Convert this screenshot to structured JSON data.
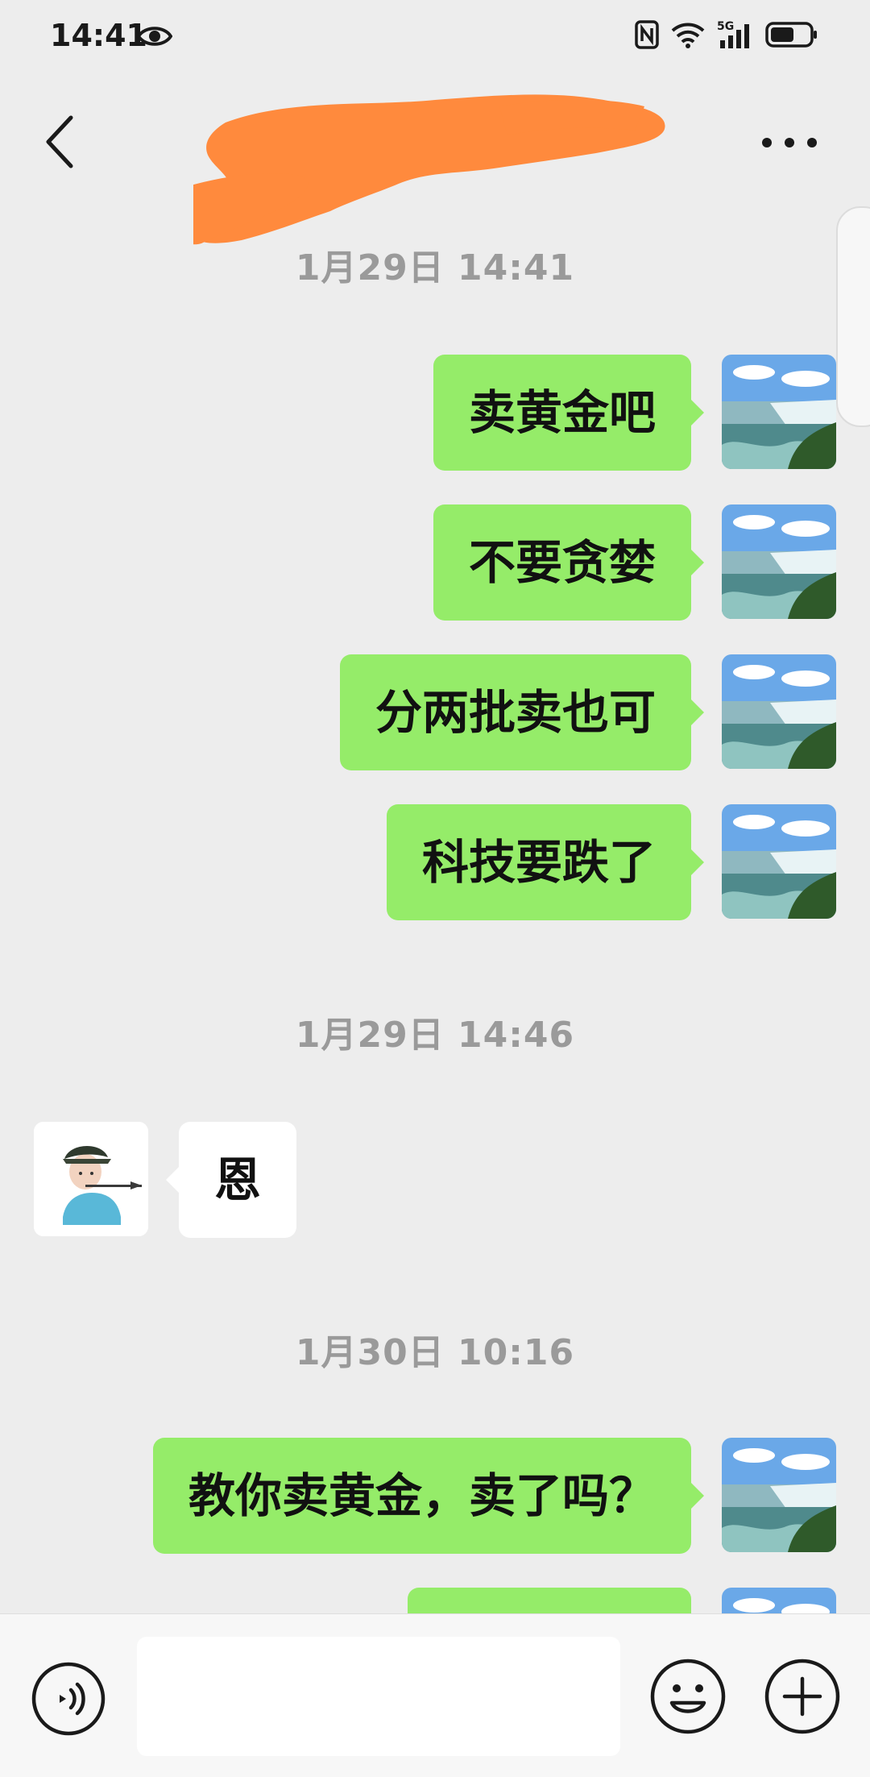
{
  "status_bar": {
    "time": "14:41",
    "network_label": "5G",
    "battery_level": 0.6
  },
  "header": {
    "title": "",
    "title_redacted": true,
    "back_icon": "chevron-left-icon",
    "more_icon": "more-dots-icon"
  },
  "messages": [
    {
      "type": "timestamp",
      "text": "1月29日 14:41"
    },
    {
      "type": "message",
      "sender": "self",
      "text": "卖黄金吧"
    },
    {
      "type": "message",
      "sender": "self",
      "text": "不要贪婪"
    },
    {
      "type": "message",
      "sender": "self",
      "text": "分两批卖也可"
    },
    {
      "type": "message",
      "sender": "self",
      "text": "科技要跌了"
    },
    {
      "type": "timestamp",
      "text": "1月29日 14:46"
    },
    {
      "type": "message",
      "sender": "other",
      "text": "恩"
    },
    {
      "type": "timestamp",
      "text": "1月30日 10:16"
    },
    {
      "type": "message",
      "sender": "self",
      "text": "教你卖黄金，卖了吗？"
    },
    {
      "type": "message",
      "sender": "self",
      "text": ""
    }
  ],
  "input_bar": {
    "voice_icon": "voice-icon",
    "input_value": "",
    "emoji_icon": "emoji-icon",
    "plus_icon": "plus-icon"
  },
  "colors": {
    "background": "#ededed",
    "self_bubble": "#95ec69",
    "other_bubble": "#ffffff",
    "timestamp_text": "#9a9a9a",
    "redaction": "#ff8a3d"
  }
}
